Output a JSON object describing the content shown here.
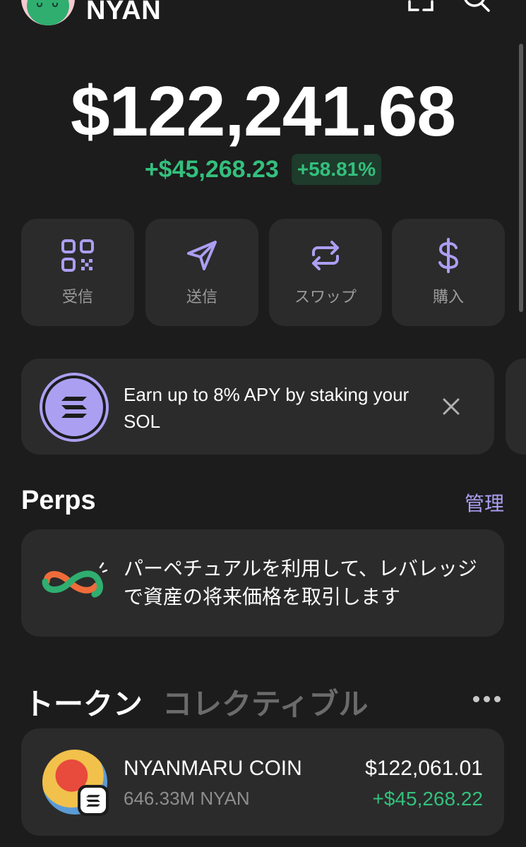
{
  "header": {
    "wallet_name": "NYAN",
    "avatar_icon": "cat-avatar",
    "scan_icon": "scan-icon",
    "search_icon": "search-icon"
  },
  "balance": {
    "total": "$122,241.68",
    "change_amount": "+$45,268.23",
    "change_percent": "+58.81%"
  },
  "actions": [
    {
      "label": "受信",
      "icon": "qr-code-icon"
    },
    {
      "label": "送信",
      "icon": "send-icon"
    },
    {
      "label": "スワップ",
      "icon": "swap-icon"
    },
    {
      "label": "購入",
      "icon": "dollar-icon"
    }
  ],
  "promo": {
    "text": "Earn up to 8% APY by staking your SOL",
    "icon": "solana-icon"
  },
  "perps": {
    "title": "Perps",
    "manage_label": "管理",
    "description": "パーペチュアルを利用して、レバレッジで資産の将来価格を取引します"
  },
  "tabs": {
    "tokens": "トークン",
    "collectibles": "コレクティブル"
  },
  "tokens": [
    {
      "name": "NYANMARU COIN",
      "quantity": "646.33M NYAN",
      "value": "$122,061.01",
      "change": "+$45,268.22"
    }
  ],
  "colors": {
    "background": "#1c1c1c",
    "card": "#2b2b2b",
    "accent": "#ab9ff2",
    "positive": "#33c07d"
  }
}
